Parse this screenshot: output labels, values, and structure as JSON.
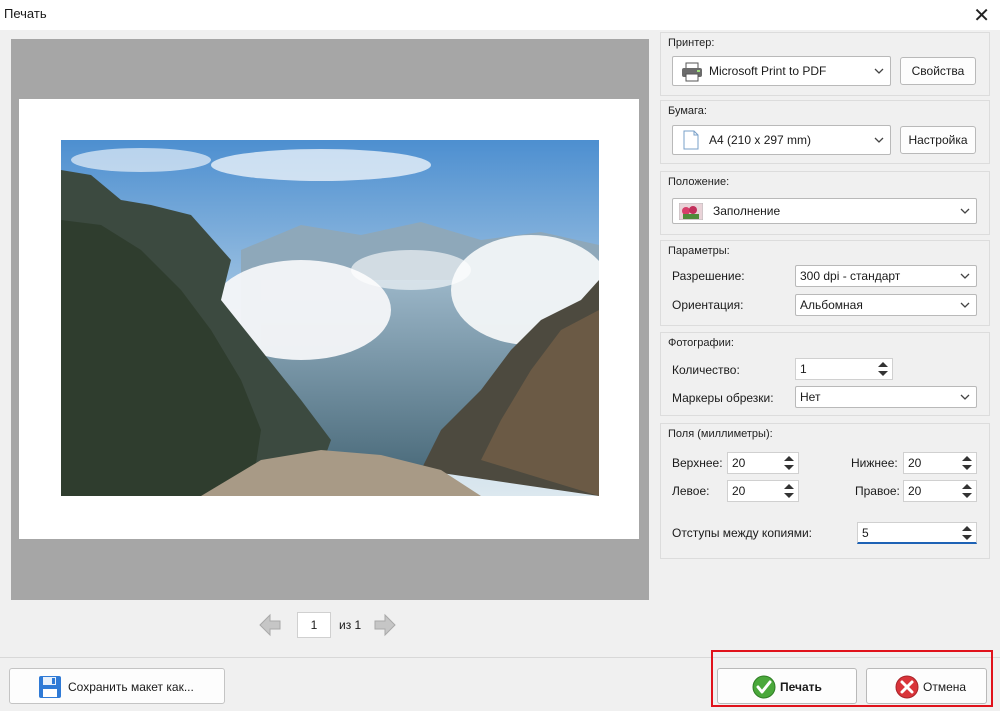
{
  "window": {
    "title": "Печать",
    "close_icon": "close-icon"
  },
  "pager": {
    "current_page": "1",
    "of_label": "из 1"
  },
  "printer": {
    "label": "Принтер:",
    "selected": "Microsoft Print to PDF",
    "icon": "printer-icon",
    "properties_button": "Свойства"
  },
  "paper": {
    "label": "Бумага:",
    "selected": "A4 (210 x 297 mm)",
    "icon": "page-icon",
    "setup_button": "Настройка"
  },
  "position": {
    "label": "Положение:",
    "selected": "Заполнение",
    "icon": "image-thumbnail-icon"
  },
  "parameters": {
    "label": "Параметры:",
    "resolution_label": "Разрешение:",
    "resolution_value": "300 dpi - стандарт",
    "orientation_label": "Ориентация:",
    "orientation_value": "Альбомная"
  },
  "photos": {
    "label": "Фотографии:",
    "quantity_label": "Количество:",
    "quantity_value": "1",
    "crop_marks_label": "Маркеры обрезки:",
    "crop_marks_value": "Нет"
  },
  "margins": {
    "label": "Поля (миллиметры):",
    "top_label": "Верхнее:",
    "top_value": "20",
    "bottom_label": "Нижнее:",
    "bottom_value": "20",
    "left_label": "Левое:",
    "left_value": "20",
    "right_label": "Правое:",
    "right_value": "20",
    "spacing_label": "Отступы между копиями:",
    "spacing_value": "5"
  },
  "footer": {
    "save_layout_button": "Сохранить макет как...",
    "print_button": "Печать",
    "cancel_button": "Отмена"
  },
  "colors": {
    "highlight": "#e0121b",
    "preview_bg": "#a6a6a6",
    "print_icon": "#4aa83b",
    "cancel_icon": "#d9343a",
    "active_field_underline": "#1d62b5"
  }
}
